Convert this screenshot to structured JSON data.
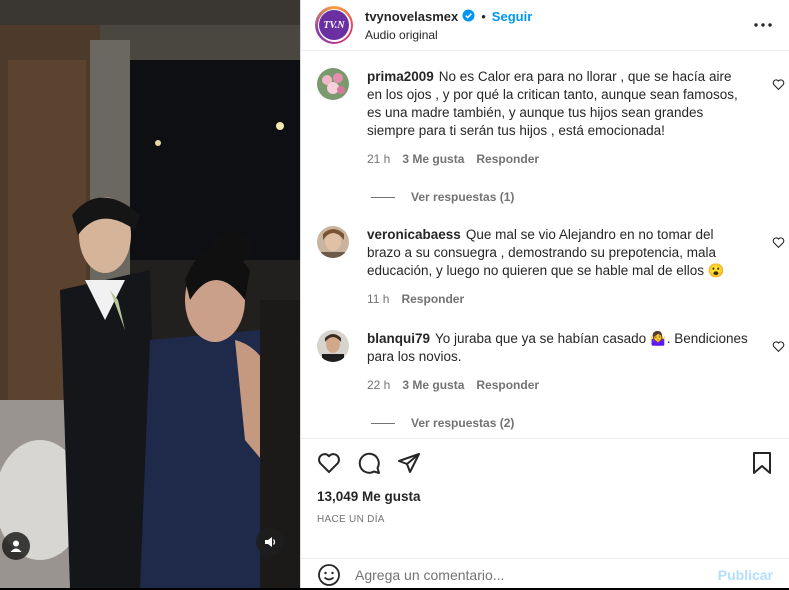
{
  "post": {
    "username": "tvynovelasmex",
    "avatar_text": "TV.N",
    "separator": "•",
    "follow_label": "Seguir",
    "audio_label": "Audio original",
    "more_icon": "more-horizontal-icon",
    "verified_color": "#0095f6"
  },
  "comments": [
    {
      "user": "prima2009",
      "text": "No es Calor era para no llorar , que se hacía aire en los ojos , y por qué la critican tanto, aunque sean famosos, es una madre también, y aunque tus hijos sean grandes siempre para ti serán tus hijos , está emocionada!",
      "time": "21 h",
      "likes": "3 Me gusta",
      "reply_label": "Responder",
      "view_replies": "Ver respuestas (1)"
    },
    {
      "user": "veronicabaess",
      "text": "Que mal se vio Alejandro en no tomar del brazo a su consuegra , demostrando su prepotencia, mala educación, y luego no quieren que se hable mal de ellos 😮",
      "time": "11 h",
      "reply_label": "Responder"
    },
    {
      "user": "blanqui79",
      "text": "Yo juraba que ya se habían casado 🤷‍♀️. Bendiciones para los novios.",
      "time": "22 h",
      "likes": "3 Me gusta",
      "reply_label": "Responder",
      "view_replies": "Ver respuestas (2)"
    }
  ],
  "actions": {
    "like_icon": "heart-icon",
    "comment_icon": "comment-icon",
    "share_icon": "share-icon",
    "save_icon": "bookmark-icon"
  },
  "likes_count": "13,049 Me gusta",
  "time_ago": "HACE UN DÍA",
  "composer": {
    "placeholder": "Agrega un comentario...",
    "publish_label": "Publicar"
  },
  "media": {
    "user_tag_icon": "user-tag-icon",
    "audio_icon": "speaker-icon"
  }
}
